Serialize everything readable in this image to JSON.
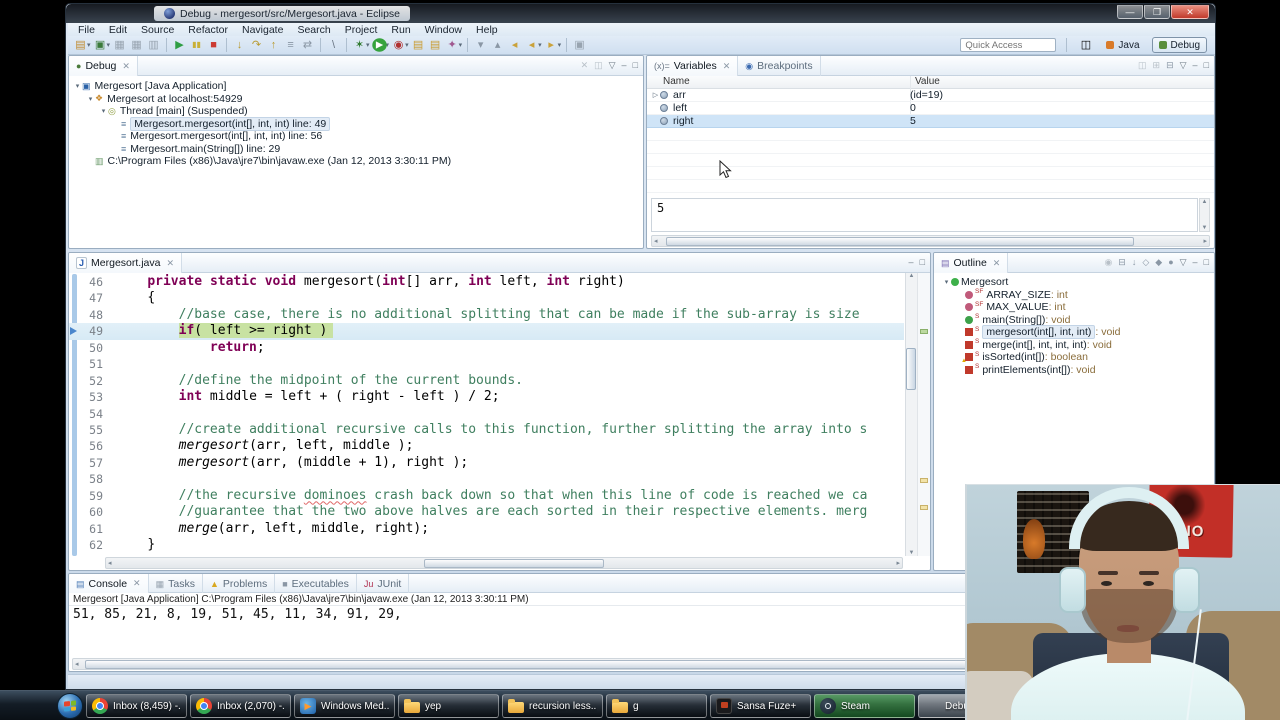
{
  "window": {
    "title": "Debug - mergesort/src/Mergesort.java - Eclipse"
  },
  "menu": [
    "File",
    "Edit",
    "Source",
    "Refactor",
    "Navigate",
    "Search",
    "Project",
    "Run",
    "Window",
    "Help"
  ],
  "toolbar": {
    "quick_access_placeholder": "Quick Access",
    "items": [
      {
        "n": "new-wizard-button",
        "g": "▤",
        "c": "#c08a2e",
        "d": 1
      },
      {
        "n": "new-java-project-button",
        "g": "▣",
        "c": "#3a7a3a",
        "d": 1
      },
      {
        "n": "save-button",
        "g": "▦",
        "c": "#98a4b0"
      },
      {
        "n": "save-all-button",
        "g": "▦",
        "c": "#98a4b0"
      },
      {
        "n": "print-button",
        "g": "▥",
        "c": "#98a4b0"
      },
      {
        "n": "resume-button",
        "g": "▶",
        "c": "#2f9e44",
        "s": 1
      },
      {
        "n": "suspend-button",
        "g": "▮▮",
        "c": "#c9b037"
      },
      {
        "n": "terminate-button",
        "g": "■",
        "c": "#cc3b33"
      },
      {
        "n": "step-into-button",
        "g": "↓",
        "c": "#b89a30",
        "s": 1
      },
      {
        "n": "step-over-button",
        "g": "↷",
        "c": "#b89a30"
      },
      {
        "n": "step-return-button",
        "g": "↑",
        "c": "#b89a30"
      },
      {
        "n": "drop-to-frame-button",
        "g": "≡",
        "c": "#8a97a5"
      },
      {
        "n": "step-filters-button",
        "g": "⇄",
        "c": "#8a97a5"
      },
      {
        "n": "mark-occurrences-button",
        "g": "\\",
        "c": "#6a7684",
        "s": 1
      },
      {
        "n": "debug-button",
        "g": "✶",
        "c": "#2f7a2f",
        "d": 1,
        "s": 1
      },
      {
        "n": "run-button",
        "g": "▶",
        "c": "#ffffff",
        "bg": "#36a33e",
        "d": 1
      },
      {
        "n": "coverage-button",
        "g": "◉",
        "c": "#b03030",
        "d": 1
      },
      {
        "n": "open-task-button",
        "g": "▤",
        "c": "#c99a2e"
      },
      {
        "n": "search-folder-button",
        "g": "▤",
        "c": "#c99a2e"
      },
      {
        "n": "external-tools-button",
        "g": "✦",
        "c": "#a05890",
        "d": 1
      },
      {
        "n": "next-annotation-button",
        "g": "▾",
        "c": "#8a97a5",
        "s": 1
      },
      {
        "n": "previous-annotation-button",
        "g": "▴",
        "c": "#8a97a5"
      },
      {
        "n": "last-edit-location-button",
        "g": "◂",
        "c": "#caa23a"
      },
      {
        "n": "back-button",
        "g": "◂",
        "c": "#caa23a",
        "d": 1
      },
      {
        "n": "forward-button",
        "g": "▸",
        "c": "#caa23a",
        "d": 1
      },
      {
        "n": "pin-editor-button",
        "g": "▣",
        "c": "#98a4b0",
        "s": 1
      }
    ],
    "perspectives": [
      {
        "label": "Java",
        "active": false,
        "dot": "#d97b2a"
      },
      {
        "label": "Debug",
        "active": true,
        "dot": "#5a8f3d"
      }
    ]
  },
  "debug_panel": {
    "tab": "Debug",
    "header_icons": [
      {
        "n": "remove-terminated-icon",
        "g": "✕",
        "c": "#b8c0c8"
      },
      {
        "n": "debug-toolbar-icon",
        "g": "◫",
        "c": "#b8c0c8"
      },
      {
        "n": "view-menu-icon",
        "g": "▽",
        "c": "#6d7984"
      },
      {
        "n": "minimize-view-icon",
        "g": "‒",
        "c": "#6d7984"
      },
      {
        "n": "maximize-view-icon",
        "g": "□",
        "c": "#6d7984"
      }
    ],
    "tree": [
      {
        "ind": 0,
        "tw": "▾",
        "ig": "▣",
        "ic": "#2a62a8",
        "label": "Mergesort [Java Application]"
      },
      {
        "ind": 1,
        "tw": "▾",
        "ig": "❖",
        "ic": "#c98a2e",
        "label": "Mergesort at localhost:54929"
      },
      {
        "ind": 2,
        "tw": "▾",
        "ig": "◎",
        "ic": "#8a9a3a",
        "label": "Thread [main] (Suspended)"
      },
      {
        "ind": 3,
        "tw": "",
        "ig": "≡",
        "ic": "#5a7a9a",
        "label": "Mergesort.mergesort(int[], int, int) line: 49",
        "selected": true
      },
      {
        "ind": 3,
        "tw": "",
        "ig": "≡",
        "ic": "#5a7a9a",
        "label": "Mergesort.mergesort(int[], int, int) line: 56"
      },
      {
        "ind": 3,
        "tw": "",
        "ig": "≡",
        "ic": "#5a7a9a",
        "label": "Mergesort.main(String[]) line: 29"
      },
      {
        "ind": 1,
        "tw": "",
        "ig": "▥",
        "ic": "#6a9a6a",
        "label": "C:\\Program Files (x86)\\Java\\jre7\\bin\\javaw.exe (Jan 12, 2013 3:30:11 PM)"
      }
    ]
  },
  "variables_panel": {
    "tabs": [
      {
        "label": "Variables",
        "active": true,
        "ig": "(x)=",
        "ic": "#6a7684",
        "close": true
      },
      {
        "label": "Breakpoints",
        "active": false,
        "ig": "◉",
        "ic": "#3a6ab0"
      }
    ],
    "header_icons": [
      {
        "n": "show-type-names-icon",
        "g": "◫",
        "c": "#b8c0c8"
      },
      {
        "n": "show-logical-structures-icon",
        "g": "⊞",
        "c": "#b8c0c8"
      },
      {
        "n": "collapse-all-icon",
        "g": "⊟",
        "c": "#8a97a5"
      },
      {
        "n": "view-menu-icon",
        "g": "▽",
        "c": "#6d7984"
      },
      {
        "n": "minimize-view-icon",
        "g": "‒",
        "c": "#6d7984"
      },
      {
        "n": "maximize-view-icon",
        "g": "□",
        "c": "#6d7984"
      }
    ],
    "columns": [
      "Name",
      "Value"
    ],
    "rows": [
      {
        "tw": "▷",
        "name": "arr",
        "value": "(id=19)"
      },
      {
        "tw": "",
        "name": "left",
        "value": "0"
      },
      {
        "tw": "",
        "name": "right",
        "value": "5",
        "selected": true
      }
    ],
    "detail_value": "5"
  },
  "editor": {
    "tab": "Mergesort.java",
    "header_icons": [
      {
        "n": "minimize-view-icon",
        "g": "‒",
        "c": "#6d7984"
      },
      {
        "n": "maximize-view-icon",
        "g": "□",
        "c": "#6d7984"
      }
    ],
    "current_line": 49,
    "lines": [
      {
        "no": 46,
        "ind": 1,
        "tokens": [
          [
            "kw",
            "private"
          ],
          [
            "pl",
            " "
          ],
          [
            "kw",
            "static"
          ],
          [
            "pl",
            " "
          ],
          [
            "kw",
            "void"
          ],
          [
            "pl",
            " mergesort("
          ],
          [
            "kw",
            "int"
          ],
          [
            "pl",
            "[] arr, "
          ],
          [
            "kw",
            "int"
          ],
          [
            "pl",
            " left, "
          ],
          [
            "kw",
            "int"
          ],
          [
            "pl",
            " right)"
          ]
        ]
      },
      {
        "no": 47,
        "ind": 1,
        "tokens": [
          [
            "pl",
            "{"
          ]
        ]
      },
      {
        "no": 48,
        "ind": 2,
        "tokens": [
          [
            "cm",
            "//base case, there is no additional splitting that can be made if the sub-array is size"
          ]
        ]
      },
      {
        "no": 49,
        "ind": 2,
        "cur": true,
        "tokens": [
          [
            "kw",
            "if"
          ],
          [
            "pl",
            "( left >= right )"
          ]
        ]
      },
      {
        "no": 50,
        "ind": 3,
        "tokens": [
          [
            "kw",
            "return"
          ],
          [
            "pl",
            ";"
          ]
        ]
      },
      {
        "no": 51,
        "ind": 0,
        "tokens": []
      },
      {
        "no": 52,
        "ind": 2,
        "tokens": [
          [
            "cm",
            "//define the midpoint of the current bounds."
          ]
        ]
      },
      {
        "no": 53,
        "ind": 2,
        "tokens": [
          [
            "kw",
            "int"
          ],
          [
            "pl",
            " middle = left + ( right - left ) / 2;"
          ]
        ]
      },
      {
        "no": 54,
        "ind": 0,
        "tokens": []
      },
      {
        "no": 55,
        "ind": 2,
        "tokens": [
          [
            "cm",
            "//create additional recursive calls to this function, further splitting the array into s"
          ]
        ]
      },
      {
        "no": 56,
        "ind": 2,
        "tokens": [
          [
            "it",
            "mergesort"
          ],
          [
            "pl",
            "(arr, left, middle );"
          ]
        ]
      },
      {
        "no": 57,
        "ind": 2,
        "tokens": [
          [
            "it",
            "mergesort"
          ],
          [
            "pl",
            "(arr, (middle + 1), right );"
          ]
        ]
      },
      {
        "no": 58,
        "ind": 0,
        "tokens": []
      },
      {
        "no": 59,
        "ind": 2,
        "tokens": [
          [
            "cm",
            "//the recursive "
          ],
          [
            "cw",
            "dominoes"
          ],
          [
            "cm",
            " crash back down so that when this line of code is reached we ca"
          ]
        ]
      },
      {
        "no": 60,
        "ind": 2,
        "tokens": [
          [
            "cm",
            "//guarantee that the two above halves are each sorted in their respective elements. merg"
          ]
        ]
      },
      {
        "no": 61,
        "ind": 2,
        "tokens": [
          [
            "it",
            "merge"
          ],
          [
            "pl",
            "(arr, left, middle, right);"
          ]
        ]
      },
      {
        "no": 62,
        "ind": 1,
        "tokens": [
          [
            "pl",
            "}"
          ]
        ]
      }
    ]
  },
  "outline_panel": {
    "tab": "Outline",
    "header_icons": [
      {
        "n": "focus-icon",
        "g": "◉",
        "c": "#b8c0c8"
      },
      {
        "n": "collapse-all-icon",
        "g": "⊟",
        "c": "#8a97a5"
      },
      {
        "n": "sort-icon",
        "g": "↓",
        "c": "#8a97a5"
      },
      {
        "n": "hide-fields-icon",
        "g": "◇",
        "c": "#8a97a5"
      },
      {
        "n": "hide-static-icon",
        "g": "◆",
        "c": "#8a97a5"
      },
      {
        "n": "hide-non-public-icon",
        "g": "●",
        "c": "#8a97a5"
      },
      {
        "n": "view-menu-icon",
        "g": "▽",
        "c": "#6d7984"
      },
      {
        "n": "minimize-view-icon",
        "g": "‒",
        "c": "#6d7984"
      },
      {
        "n": "maximize-view-icon",
        "g": "□",
        "c": "#6d7984"
      }
    ],
    "items": [
      {
        "ind": 0,
        "tw": "▾",
        "shape": "circle",
        "color": "#3db04a",
        "mod": "",
        "label": "Mergesort",
        "type": ""
      },
      {
        "ind": 1,
        "tw": "",
        "shape": "circle",
        "color": "#c05a7a",
        "mod": "SF",
        "label": "ARRAY_SIZE",
        "type": " : int"
      },
      {
        "ind": 1,
        "tw": "",
        "shape": "circle",
        "color": "#c05a7a",
        "mod": "SF",
        "label": "MAX_VALUE",
        "type": " : int"
      },
      {
        "ind": 1,
        "tw": "",
        "shape": "circle",
        "color": "#3da14a",
        "mod": "S",
        "label": "main(String[])",
        "type": " : void"
      },
      {
        "ind": 1,
        "tw": "",
        "shape": "square",
        "color": "#c0392b",
        "mod": "S",
        "label": "mergesort(int[], int, int)",
        "type": " : void",
        "selected": true
      },
      {
        "ind": 1,
        "tw": "",
        "shape": "square",
        "color": "#c0392b",
        "mod": "S",
        "label": "merge(int[], int, int, int)",
        "type": " : void"
      },
      {
        "ind": 1,
        "tw": "",
        "shape": "square",
        "color": "#c0392b",
        "mod": "S",
        "label": "isSorted(int[])",
        "type": " : boolean",
        "warn": true
      },
      {
        "ind": 1,
        "tw": "",
        "shape": "square",
        "color": "#c0392b",
        "mod": "S",
        "label": "printElements(int[])",
        "type": " : void"
      }
    ]
  },
  "console_panel": {
    "tabs": [
      {
        "label": "Console",
        "active": true,
        "ig": "▤",
        "ic": "#4a7ab5",
        "close": true
      },
      {
        "label": "Tasks",
        "active": false,
        "ig": "▦",
        "ic": "#98a4b0"
      },
      {
        "label": "Problems",
        "active": false,
        "ig": "▲",
        "ic": "#d9a820"
      },
      {
        "label": "Executables",
        "active": false,
        "ig": "■",
        "ic": "#8a97a5"
      },
      {
        "label": "JUnit",
        "active": false,
        "ig": "Ju",
        "ic": "#b03050"
      }
    ],
    "info_line": "Mergesort [Java Application] C:\\Program Files (x86)\\Java\\jre7\\bin\\javaw.exe (Jan 12, 2013 3:30:11 PM)",
    "output": "51, 85, 21, 8, 19, 51, 45, 11, 34, 91, 29,"
  },
  "taskbar": {
    "buttons": [
      {
        "icon": "chrome",
        "label": "Inbox (8,459) -..."
      },
      {
        "icon": "chrome",
        "label": "Inbox (2,070) -..."
      },
      {
        "icon": "wmp",
        "label": "Windows Med..."
      },
      {
        "icon": "folder",
        "label": "yep"
      },
      {
        "icon": "folder",
        "label": "recursion less..."
      },
      {
        "icon": "folder",
        "label": "g"
      },
      {
        "icon": "sansa",
        "label": "Sansa Fuze+"
      },
      {
        "icon": "steam",
        "label": "Steam",
        "variant": "steam"
      },
      {
        "icon": "eclipse",
        "label": "Debug - merg...",
        "variant": "active"
      }
    ]
  },
  "webcam": {
    "poster_text": "DIO"
  },
  "colors": {
    "keyword": "#7f0055",
    "comment": "#3f7f5f",
    "current_line_highlight": "#c8e2a2",
    "selection_blue": "#cfe4f7",
    "taskbar_steam_green": "#4caf50"
  }
}
